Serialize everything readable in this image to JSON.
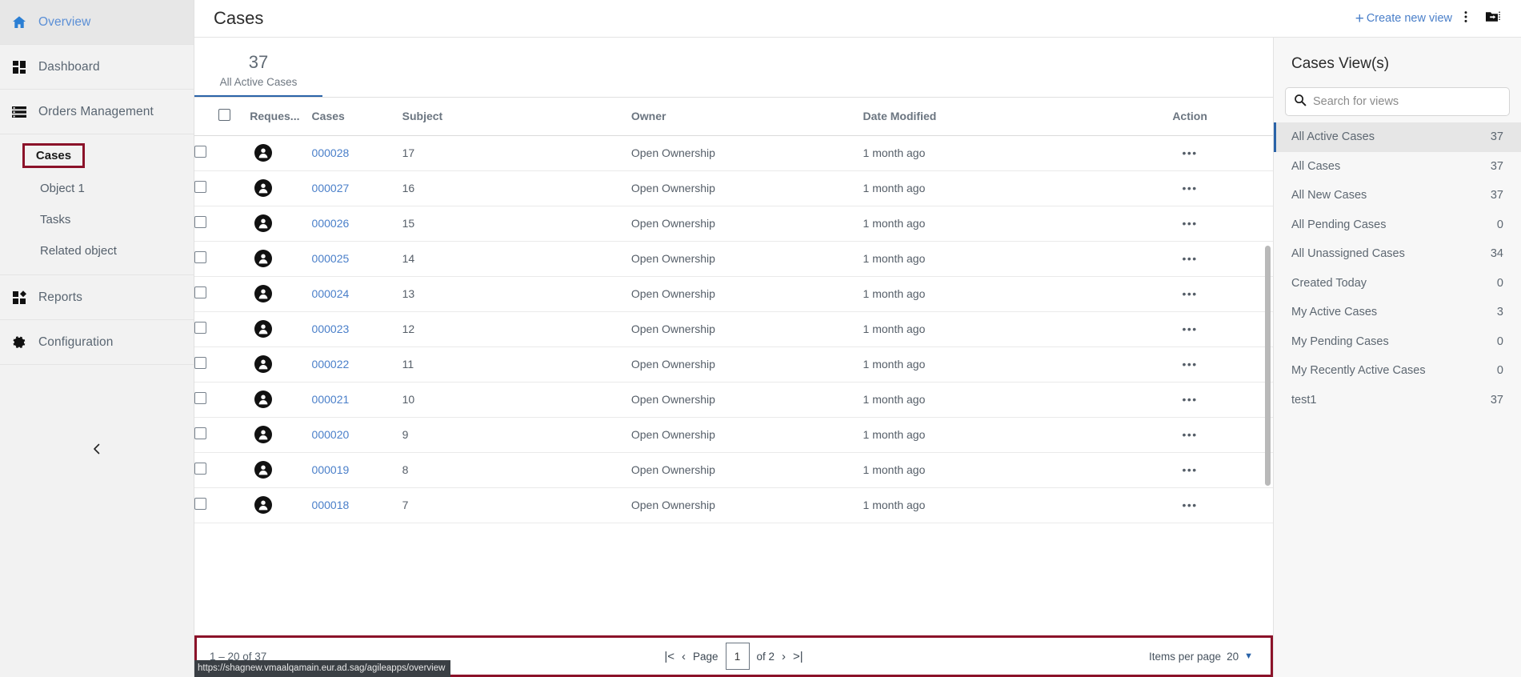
{
  "sidebar": {
    "items": [
      {
        "label": "Overview",
        "icon": "home-icon",
        "active": true
      },
      {
        "label": "Dashboard",
        "icon": "dashboard-icon",
        "active": false
      },
      {
        "label": "Orders Management",
        "icon": "list-icon",
        "active": false
      }
    ],
    "sub_items": [
      {
        "label": "Cases",
        "highlighted": true
      },
      {
        "label": "Object 1",
        "highlighted": false
      },
      {
        "label": "Tasks",
        "highlighted": false
      },
      {
        "label": "Related object",
        "highlighted": false
      }
    ],
    "items_after": [
      {
        "label": "Reports",
        "icon": "reports-icon",
        "active": false
      },
      {
        "label": "Configuration",
        "icon": "gear-icon",
        "active": false
      }
    ],
    "collapse_icon": "chevron-left-icon"
  },
  "header": {
    "title": "Cases",
    "create_view_label": "Create new view",
    "create_view_icon": "plus-icon",
    "more_icon": "vertical-dots-icon",
    "export_icon": "share-folder-icon"
  },
  "kpi": {
    "tabs": [
      {
        "count": "37",
        "label": "All Active Cases",
        "selected": true
      }
    ]
  },
  "table": {
    "columns": [
      {
        "key": "select",
        "label": ""
      },
      {
        "key": "requester",
        "label": "Reques..."
      },
      {
        "key": "cases",
        "label": "Cases"
      },
      {
        "key": "subject",
        "label": "Subject"
      },
      {
        "key": "owner",
        "label": "Owner"
      },
      {
        "key": "date_modified",
        "label": "Date Modified"
      },
      {
        "key": "action",
        "label": "Action"
      }
    ],
    "rows": [
      {
        "case": "000028",
        "subject": "17",
        "owner": "Open Ownership",
        "date": "1 month ago",
        "action": "•••"
      },
      {
        "case": "000027",
        "subject": "16",
        "owner": "Open Ownership",
        "date": "1 month ago",
        "action": "•••"
      },
      {
        "case": "000026",
        "subject": "15",
        "owner": "Open Ownership",
        "date": "1 month ago",
        "action": "•••"
      },
      {
        "case": "000025",
        "subject": "14",
        "owner": "Open Ownership",
        "date": "1 month ago",
        "action": "•••"
      },
      {
        "case": "000024",
        "subject": "13",
        "owner": "Open Ownership",
        "date": "1 month ago",
        "action": "•••"
      },
      {
        "case": "000023",
        "subject": "12",
        "owner": "Open Ownership",
        "date": "1 month ago",
        "action": "•••"
      },
      {
        "case": "000022",
        "subject": "11",
        "owner": "Open Ownership",
        "date": "1 month ago",
        "action": "•••"
      },
      {
        "case": "000021",
        "subject": "10",
        "owner": "Open Ownership",
        "date": "1 month ago",
        "action": "•••"
      },
      {
        "case": "000020",
        "subject": "9",
        "owner": "Open Ownership",
        "date": "1 month ago",
        "action": "•••"
      },
      {
        "case": "000019",
        "subject": "8",
        "owner": "Open Ownership",
        "date": "1 month ago",
        "action": "•••"
      },
      {
        "case": "000018",
        "subject": "7",
        "owner": "Open Ownership",
        "date": "1 month ago",
        "action": "•••"
      }
    ]
  },
  "pager": {
    "range_label": "1 – 20 of 37",
    "first_icon": "|<",
    "prev_icon": "‹",
    "page_label": "Page",
    "page_value": "1",
    "of_label": "of 2",
    "next_icon": "›",
    "last_icon": ">|",
    "items_per_page_label": "Items per page",
    "items_per_page_value": "20",
    "caret_icon": "caret-down-icon"
  },
  "views": {
    "title": "Cases View(s)",
    "search_placeholder": "Search for views",
    "search_value": "",
    "search_icon": "search-icon",
    "items": [
      {
        "label": "All Active Cases",
        "count": "37",
        "selected": true
      },
      {
        "label": "All Cases",
        "count": "37",
        "selected": false
      },
      {
        "label": "All New Cases",
        "count": "37",
        "selected": false
      },
      {
        "label": "All Pending Cases",
        "count": "0",
        "selected": false
      },
      {
        "label": "All Unassigned Cases",
        "count": "34",
        "selected": false
      },
      {
        "label": "Created Today",
        "count": "0",
        "selected": false
      },
      {
        "label": "My Active Cases",
        "count": "3",
        "selected": false
      },
      {
        "label": "My Pending Cases",
        "count": "0",
        "selected": false
      },
      {
        "label": "My Recently Active Cases",
        "count": "0",
        "selected": false
      },
      {
        "label": "test1",
        "count": "37",
        "selected": false
      }
    ]
  },
  "status_bar": {
    "url": "https://shagnew.vmaalqamain.eur.ad.sag/agileapps/overview"
  },
  "colors": {
    "accent_blue": "#2a63a8",
    "link_blue": "#4a7fc9",
    "row_flag_green": "#3fcf98",
    "highlight_red": "#8b1229",
    "sidebar_bg": "#f2f2f2",
    "panel_bg": "#f7f7f7"
  }
}
